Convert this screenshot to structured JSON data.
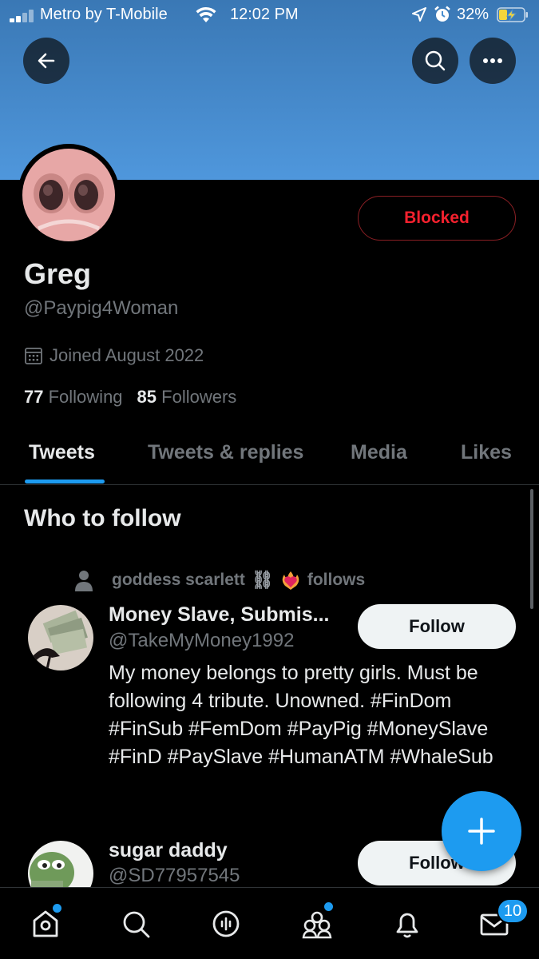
{
  "status_bar": {
    "carrier": "Metro by T-Mobile",
    "time": "12:02 PM",
    "battery": "32%"
  },
  "profile": {
    "display_name": "Greg",
    "handle": "@Paypig4Woman",
    "joined": "Joined August 2022",
    "following_count": "77",
    "following_label": "Following",
    "followers_count": "85",
    "followers_label": "Followers",
    "blocked_label": "Blocked"
  },
  "tabs": [
    {
      "label": "Tweets",
      "active": true
    },
    {
      "label": "Tweets & replies",
      "active": false
    },
    {
      "label": "Media",
      "active": false
    },
    {
      "label": "Likes",
      "active": false
    }
  ],
  "who_to_follow": {
    "title": "Who to follow",
    "social_context_name": "goddess scarlett",
    "social_context_suffix": "follows",
    "users": [
      {
        "name": "Money Slave, Submis...",
        "handle": "@TakeMyMoney1992",
        "bio": "My money belongs to pretty girls. Must be following 4 tribute. Unowned. #FinDom #FinSub #FemDom #PayPig #MoneySlave #FinD #PaySlave #HumanATM #WhaleSub",
        "follow_label": "Follow"
      },
      {
        "name": "sugar daddy",
        "handle": "@SD77957545",
        "follow_label": "Follow"
      }
    ]
  },
  "bottom_nav": {
    "messages_badge": "10"
  },
  "colors": {
    "accent": "#1d9bf0",
    "blocked": "#f4212e",
    "banner": "#4f97dc"
  }
}
